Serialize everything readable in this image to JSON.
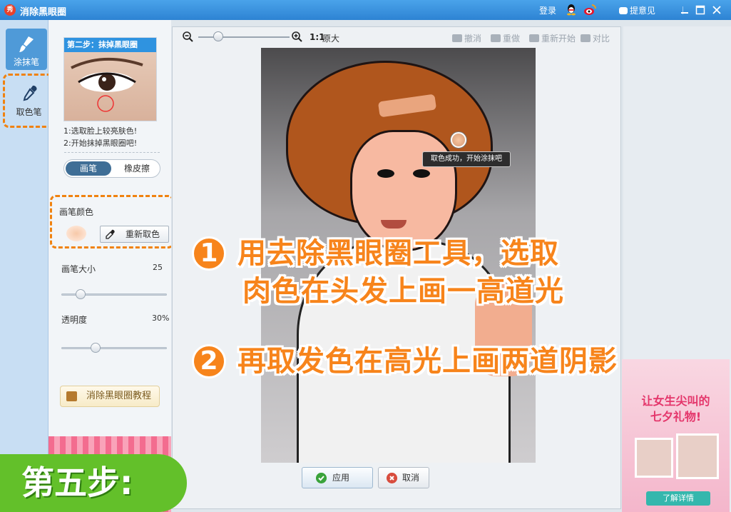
{
  "app": {
    "logo_text": "秀",
    "title": "消除黑眼圈"
  },
  "titlebar": {
    "login": "登录",
    "feedback": "提意见"
  },
  "tools": [
    {
      "label": "涂抹笔"
    },
    {
      "label": "取色笔"
    }
  ],
  "step_card": {
    "header": "第二步：抹掉黑眼圈"
  },
  "tips": [
    "1:选取脸上较亮肤色!",
    "2:开始抹掉黑眼圈吧!"
  ],
  "mode": {
    "brush": "画笔",
    "eraser": "橡皮擦",
    "selected": "画笔"
  },
  "brush_color": {
    "label": "画笔颜色",
    "color": "#f7c8a8",
    "repick_label": "重新取色"
  },
  "brush_size": {
    "label": "画笔大小",
    "value": "25",
    "fraction": 0.14
  },
  "opacity": {
    "label": "透明度",
    "value": "30%",
    "fraction": 0.3
  },
  "tutorial": {
    "label": "消除黑眼圈教程"
  },
  "toolbar": {
    "zoom_fraction": 0.22,
    "zoom_ratio": "1:1",
    "zoom_original": "原大",
    "undo": "撤消",
    "redo": "重做",
    "restart": "重新开始",
    "compare": "对比"
  },
  "canvas": {
    "tooltip": "取色成功，开始涂抹吧"
  },
  "actions": {
    "apply": "应用",
    "cancel": "取消"
  },
  "promo": {
    "line1": "让女生尖叫的",
    "line2": "七夕礼物!",
    "button": "了解详情"
  },
  "overlay": {
    "step1_num": "1",
    "step1_line1": "用去除黑眼圈工具，选取",
    "step1_line2": "肉色在头发上画一高道光",
    "step2_num": "2",
    "step2_text": "再取发色在高光上画两道阴影",
    "banner": "第五步:"
  },
  "colors": {
    "accent": "#f7841b",
    "titlebar": "#2d83d3",
    "banner": "#63c02a"
  }
}
